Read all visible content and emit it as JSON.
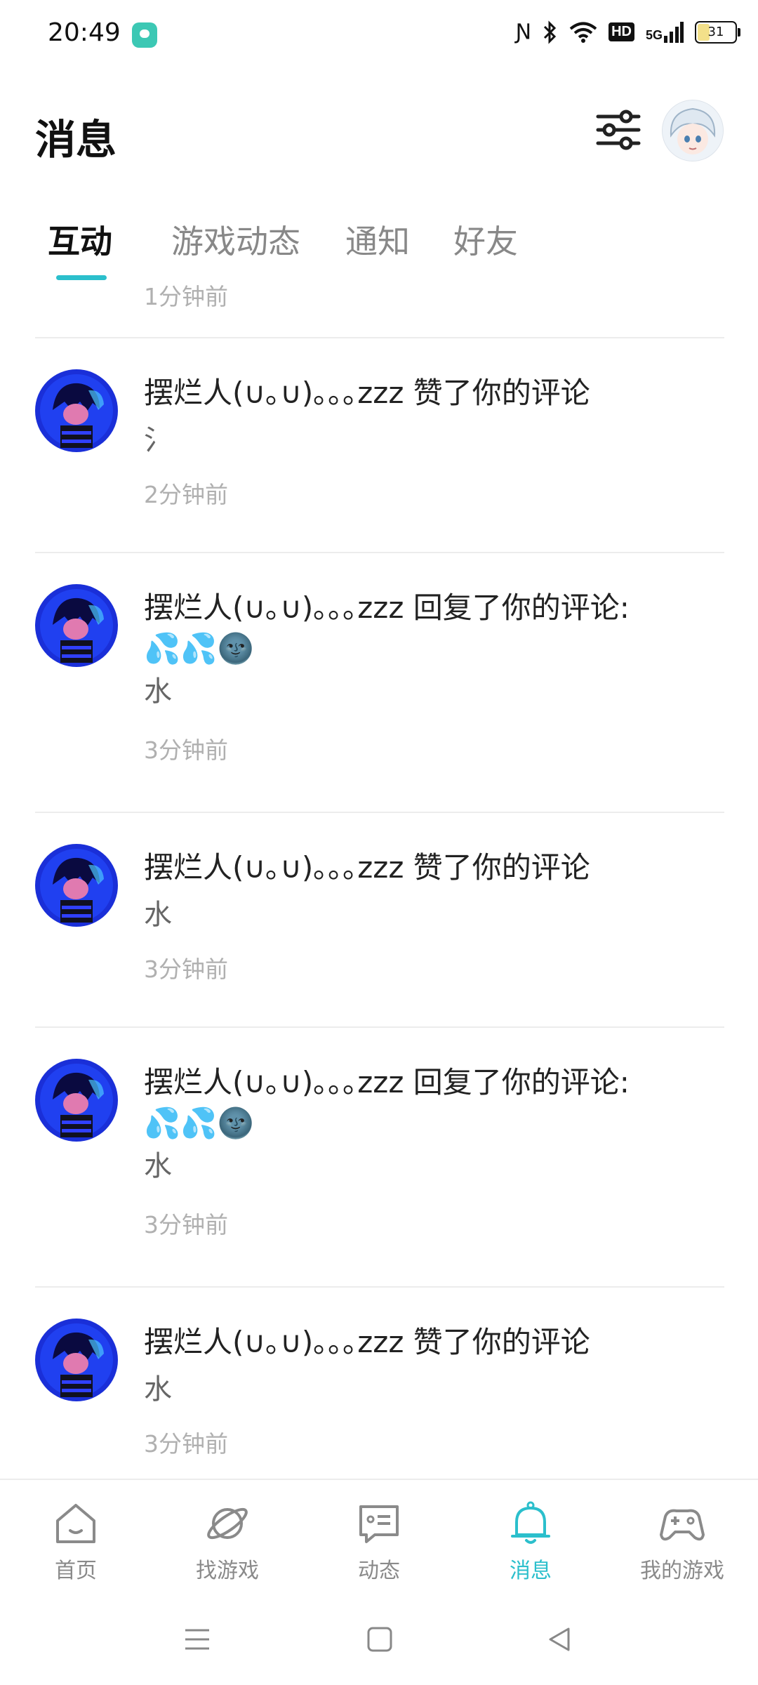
{
  "status_bar": {
    "time": "20:49",
    "network": "5G",
    "hd": "HD",
    "battery": "31"
  },
  "header": {
    "title": "消息",
    "filter_icon": "filter-sliders-icon",
    "avatar": "user-avatar"
  },
  "tabs": [
    {
      "label": "互动",
      "active": true
    },
    {
      "label": "游戏动态",
      "active": false
    },
    {
      "label": "通知",
      "active": false
    },
    {
      "label": "好友",
      "active": false
    }
  ],
  "messages": {
    "partial_top_time": "1分钟前",
    "items": [
      {
        "user": "摆烂人(∪｡∪)｡｡｡zzz",
        "action": "赞了你的评论",
        "emoji": "",
        "body": "氵",
        "time": "2分钟前"
      },
      {
        "user": "摆烂人(∪｡∪)｡｡｡zzz",
        "action": "回复了你的评论:",
        "emoji": "💦💦🌚",
        "body": "水",
        "time": "3分钟前"
      },
      {
        "user": "摆烂人(∪｡∪)｡｡｡zzz",
        "action": "赞了你的评论",
        "emoji": "",
        "body": "水",
        "time": "3分钟前"
      },
      {
        "user": "摆烂人(∪｡∪)｡｡｡zzz",
        "action": "回复了你的评论:",
        "emoji": "💦💦🌚",
        "body": "水",
        "time": "3分钟前"
      },
      {
        "user": "摆烂人(∪｡∪)｡｡｡zzz",
        "action": "赞了你的评论",
        "emoji": "",
        "body": "水",
        "time": "3分钟前"
      }
    ]
  },
  "bottom_nav": [
    {
      "label": "首页",
      "icon": "home-icon",
      "active": false
    },
    {
      "label": "找游戏",
      "icon": "planet-icon",
      "active": false
    },
    {
      "label": "动态",
      "icon": "chat-bubble-icon",
      "active": false
    },
    {
      "label": "消息",
      "icon": "bell-icon",
      "active": true
    },
    {
      "label": "我的游戏",
      "icon": "gamepad-icon",
      "active": false
    }
  ],
  "colors": {
    "accent": "#2bbfcc",
    "text_primary": "#222222",
    "text_secondary": "#666666",
    "text_muted": "#b0b0b0",
    "divider": "#ececec"
  }
}
